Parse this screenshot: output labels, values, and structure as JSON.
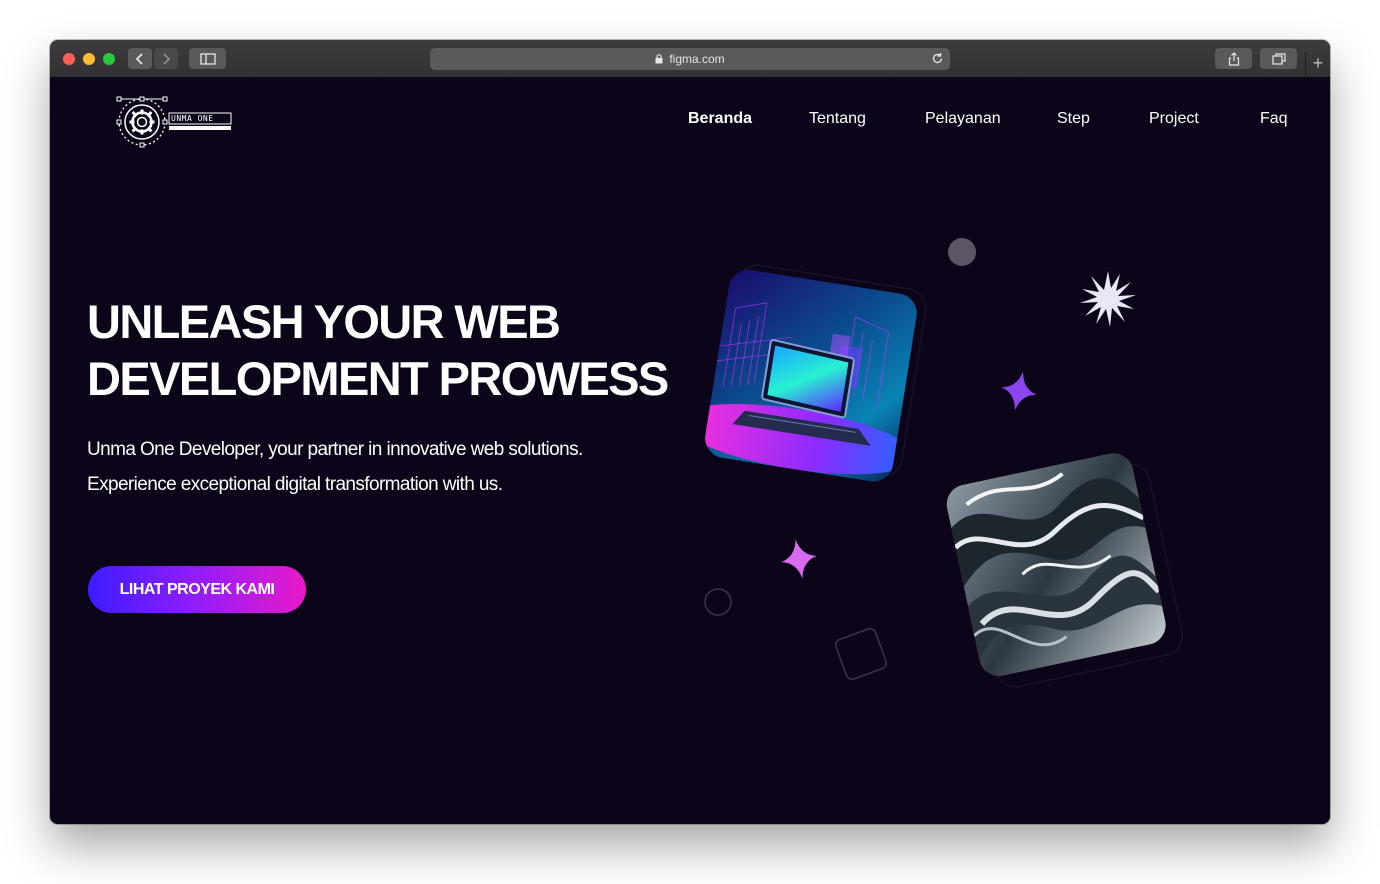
{
  "browser": {
    "address": "figma.com",
    "new_tab_label": "+"
  },
  "brand": {
    "logo_text": "UNMA ONE"
  },
  "nav": {
    "items": [
      {
        "label": "Beranda",
        "active": true
      },
      {
        "label": "Tentang",
        "active": false
      },
      {
        "label": "Pelayanan",
        "active": false
      },
      {
        "label": "Step",
        "active": false
      },
      {
        "label": "Project",
        "active": false
      },
      {
        "label": "Faq",
        "active": false
      }
    ]
  },
  "hero": {
    "title_line1": "UNLEASH YOUR WEB",
    "title_line2": "DEVELOPMENT PROWESS",
    "subtitle_line1": "Unma One Developer, your partner in innovative web solutions.",
    "subtitle_line2": "Experience exceptional digital transformation with us.",
    "cta_label": "LIHAT PROYEK KAMI"
  },
  "colors": {
    "background": "#0c0418",
    "accent_blue": "#3b1dff",
    "accent_pink": "#e81ac9",
    "sparkle_purple": "#8b46f2",
    "sparkle_pink": "#d66bf0"
  },
  "icons": [
    "back-arrow-icon",
    "forward-arrow-icon",
    "sidebar-icon",
    "lock-icon",
    "reload-icon",
    "share-icon",
    "tabs-icon",
    "gear-logo-icon",
    "starburst-icon",
    "sparkle-icon"
  ]
}
